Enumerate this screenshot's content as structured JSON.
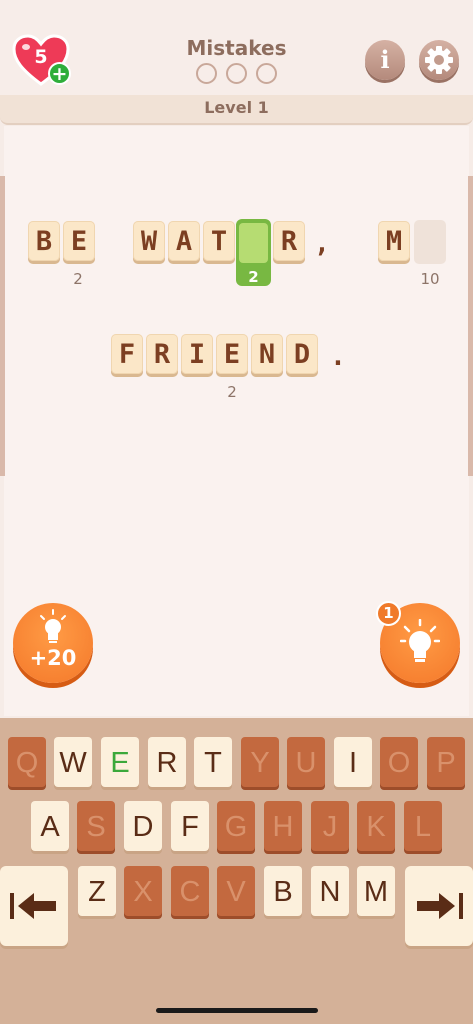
{
  "header": {
    "lives": "5",
    "add_life": "+",
    "mistakes_label": "Mistakes",
    "mistake_slots": 3,
    "info_label": "i"
  },
  "level_label": "Level 1",
  "puzzle": {
    "line1": {
      "letters": [
        "B",
        "E",
        "W",
        "A",
        "T",
        "R",
        "M"
      ],
      "punct": [
        ","
      ],
      "numbers": [
        "2",
        "2",
        "10"
      ]
    },
    "line2": {
      "letters": [
        "F",
        "R",
        "I",
        "E",
        "N",
        "D"
      ],
      "punct": [
        "."
      ],
      "numbers": [
        "2"
      ]
    }
  },
  "hints": {
    "buy_label": "+20",
    "count": "1"
  },
  "keyboard": {
    "row1": [
      "Q",
      "W",
      "E",
      "R",
      "T",
      "Y",
      "U",
      "I",
      "O",
      "P"
    ],
    "row2": [
      "A",
      "S",
      "D",
      "F",
      "G",
      "H",
      "J",
      "K",
      "L"
    ],
    "row3": [
      "Z",
      "X",
      "C",
      "V",
      "B",
      "N",
      "M"
    ]
  },
  "colors": {
    "heart": "#ee3a57",
    "accent_orange": "#f4782a",
    "selected_green": "#78b842",
    "tile": "#fbe7c8",
    "disabled_key": "#c3693f",
    "letter": "#7c3f22"
  }
}
